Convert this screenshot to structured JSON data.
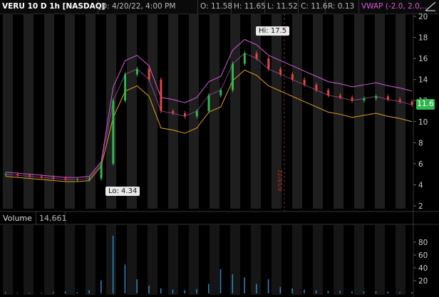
{
  "header": {
    "symbol": "VERU 10 D 1h [NASDAQ]",
    "date": "D: 4/20/22, 4:00 PM",
    "open": "O: 11.58",
    "high": "H: 11.65",
    "low": "L: 11.52",
    "close": "C: 11.6",
    "range": "R: 0.13",
    "vwap": "VWAP (-2.0, 2.0,..."
  },
  "annotations": {
    "hi_label": "Hi: 17.5",
    "lo_label": "Lo: 4.34",
    "current_price": "11.6",
    "date_marker": "4/18/22"
  },
  "price_axis": [
    "20",
    "18",
    "16",
    "14",
    "12",
    "10",
    "8",
    "6",
    "4",
    "2"
  ],
  "volume": {
    "label": "Volume",
    "value": "14,661",
    "axis": [
      "80",
      "60",
      "40",
      "20"
    ]
  },
  "colors": {
    "vwap": "#d35cd6",
    "band": "#e0a020",
    "up": "#2fb84d",
    "down": "#e0463c",
    "volume_bar": "#2a88c6"
  },
  "chart_data": {
    "type": "line",
    "price_ylim": [
      2,
      20
    ],
    "hi": 17.5,
    "lo": 4.34,
    "last": 11.6,
    "series": [
      {
        "values": [
          5.0,
          4.9,
          4.8,
          4.7,
          4.6,
          4.5,
          4.5,
          4.6,
          6.0,
          12.0,
          14.5,
          15.0,
          14.0,
          11.0,
          10.8,
          10.5,
          11.0,
          12.5,
          13.0,
          15.5,
          16.5,
          16.0,
          15.0,
          14.5,
          14.0,
          13.5,
          13.0,
          12.5,
          12.3,
          12.0,
          12.2,
          12.4,
          12.1,
          11.9,
          11.6
        ]
      }
    ],
    "volume_values": [
      2,
      1,
      1,
      1,
      2,
      3,
      2,
      5,
      20,
      90,
      45,
      22,
      12,
      8,
      6,
      5,
      7,
      15,
      38,
      30,
      25,
      15,
      22,
      10,
      8,
      6,
      5,
      4,
      4,
      3,
      3,
      3,
      3,
      2,
      2
    ],
    "volume_ylim": [
      0,
      100
    ]
  }
}
